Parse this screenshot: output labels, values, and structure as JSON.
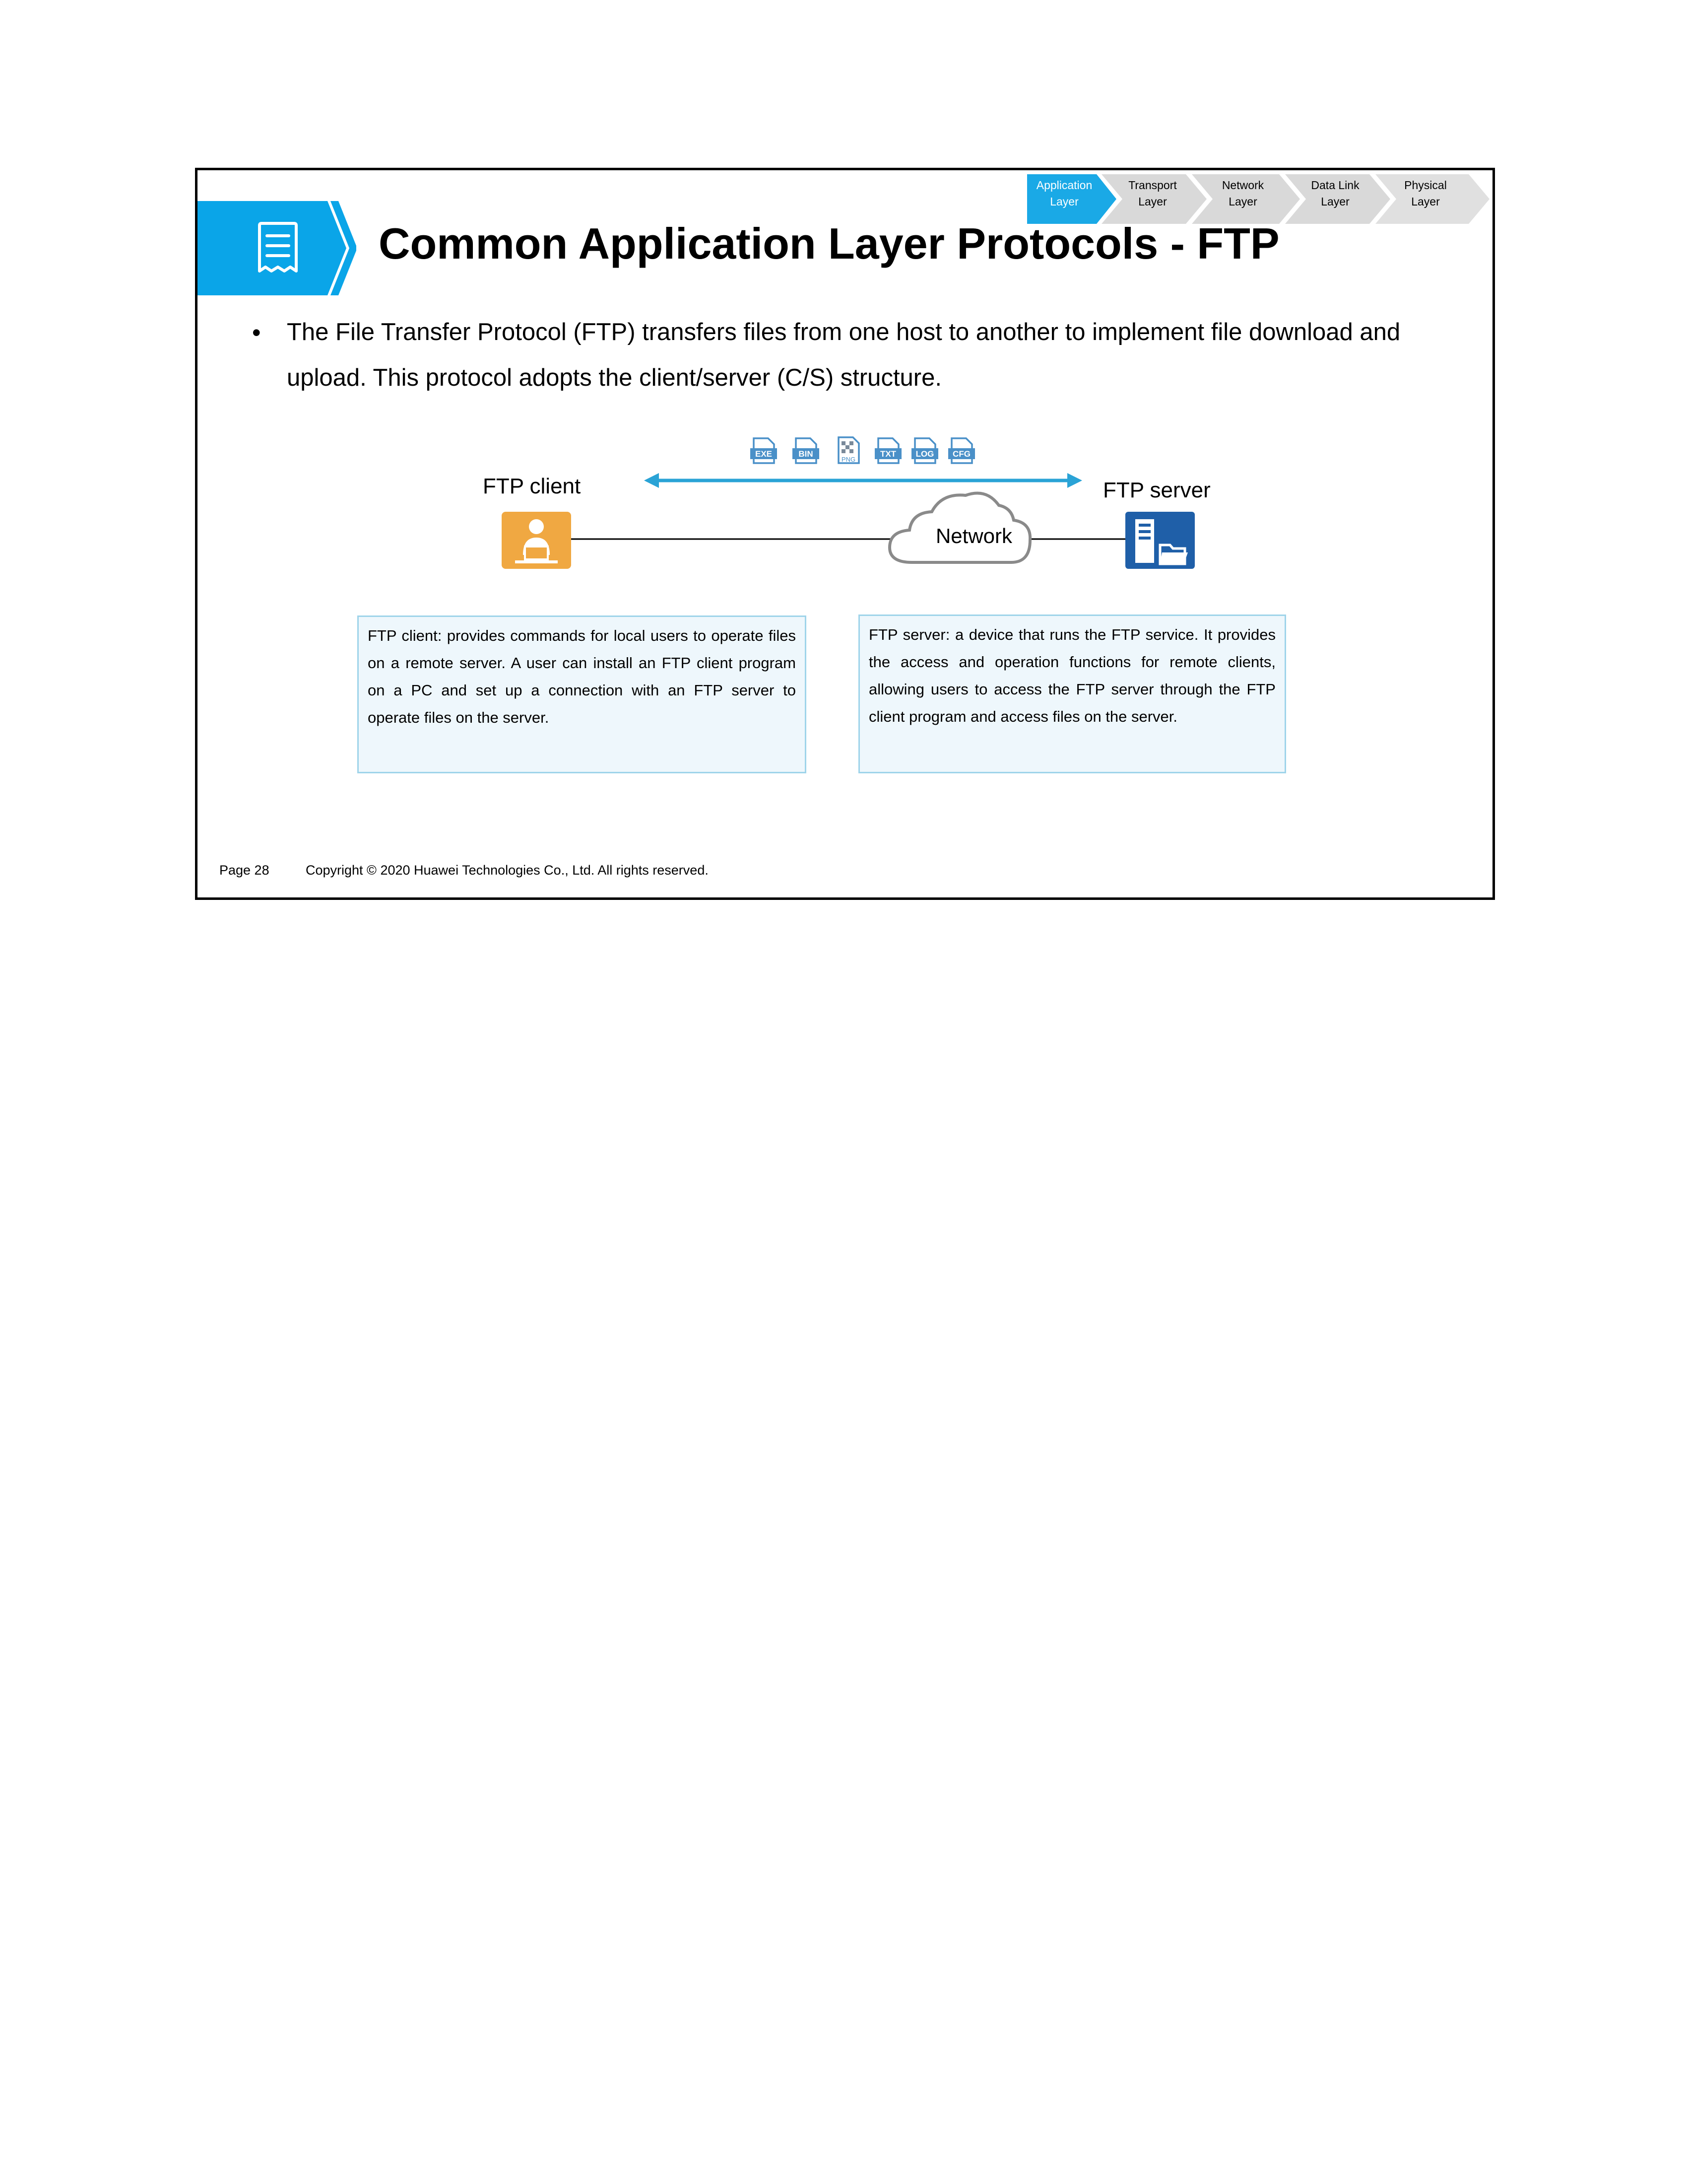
{
  "slide": {
    "title": "Common Application Layer Protocols - FTP",
    "bullet": "The File Transfer Protocol (FTP) transfers files from one host to another to implement file download and upload. This protocol adopts the client/server (C/S) structure.",
    "layers": [
      {
        "line1": "Application",
        "line2": "Layer",
        "active": true
      },
      {
        "line1": "Transport",
        "line2": "Layer",
        "active": false
      },
      {
        "line1": "Network",
        "line2": "Layer",
        "active": false
      },
      {
        "line1": "Data Link",
        "line2": "Layer",
        "active": false
      },
      {
        "line1": "Physical",
        "line2": "Layer",
        "active": false
      }
    ],
    "diagram": {
      "client_label": "FTP client",
      "server_label": "FTP server",
      "network_label": "Network",
      "file_types": [
        "EXE",
        "BIN",
        "PNG",
        "TXT",
        "LOG",
        "CFG"
      ]
    },
    "client_box": "FTP client: provides commands for local users to operate files on a remote server. A user can install an FTP client program on a PC and set up a connection with an FTP server to operate files on the server.",
    "server_box": "FTP server: a device that runs the FTP service. It provides the access and operation functions for remote clients, allowing users to access the FTP server through the FTP client program and access files on the server.",
    "footer": {
      "page": "Page 28",
      "copyright": "Copyright © 2020 Huawei Technologies Co., Ltd. All rights reserved."
    }
  },
  "colors": {
    "accent": "#0aa5e8",
    "active_layer": "#1aa9e6",
    "inactive_layer": "#d9d9d9",
    "client_icon": "#f0a842",
    "server_icon": "#1f5fa8",
    "box_fill": "#eef7fc",
    "box_border": "#9fd4ea"
  }
}
